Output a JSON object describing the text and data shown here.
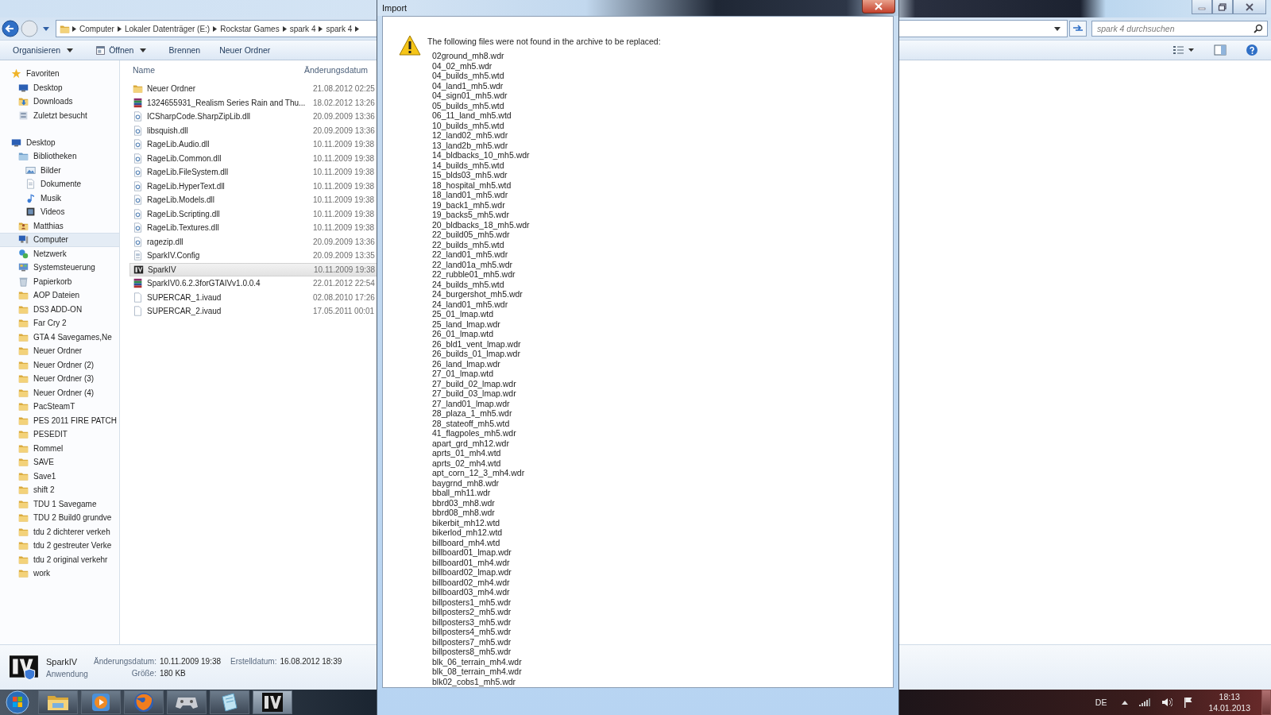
{
  "explorer": {
    "breadcrumb": [
      "Computer",
      "Lokaler Datenträger (E:)",
      "Rockstar Games",
      "spark 4",
      "spark 4"
    ],
    "search": {
      "placeholder": "spark 4 durchsuchen"
    },
    "toolbar": [
      {
        "label": "Organisieren",
        "kind": "menu"
      },
      {
        "label": "Öffnen",
        "kind": "split"
      },
      {
        "label": "Brennen",
        "kind": "plain"
      },
      {
        "label": "Neuer Ordner",
        "kind": "plain"
      }
    ],
    "nav": [
      {
        "label": "Favoriten",
        "kind": "star",
        "selected": false,
        "children": [
          {
            "label": "Desktop",
            "kind": "monitor",
            "selected": false
          },
          {
            "label": "Downloads",
            "kind": "downloads",
            "selected": false
          },
          {
            "label": "Zuletzt besucht",
            "kind": "recent",
            "selected": false
          }
        ]
      },
      {
        "label": "Desktop",
        "kind": "monitor",
        "selected": false,
        "children": [
          {
            "label": "Bibliotheken",
            "kind": "library",
            "selected": false,
            "children": [
              {
                "label": "Bilder",
                "kind": "pictures",
                "selected": false
              },
              {
                "label": "Dokumente",
                "kind": "documents",
                "selected": false
              },
              {
                "label": "Musik",
                "kind": "music",
                "selected": false
              },
              {
                "label": "Videos",
                "kind": "videos",
                "selected": false
              }
            ]
          },
          {
            "label": "Matthias",
            "kind": "user",
            "selected": false
          },
          {
            "label": "Computer",
            "kind": "computer",
            "selected": true
          },
          {
            "label": "Netzwerk",
            "kind": "network",
            "selected": false
          },
          {
            "label": "Systemsteuerung",
            "kind": "controlpanel",
            "selected": false
          },
          {
            "label": "Papierkorb",
            "kind": "trash",
            "selected": false
          },
          {
            "label": "AOP Dateien",
            "kind": "folder",
            "selected": false
          },
          {
            "label": "DS3 ADD-ON",
            "kind": "folder",
            "selected": false
          },
          {
            "label": "Far Cry 2",
            "kind": "folder",
            "selected": false
          },
          {
            "label": "GTA 4 Savegames,Ne",
            "kind": "folder",
            "selected": false
          },
          {
            "label": "Neuer Ordner",
            "kind": "folder",
            "selected": false
          },
          {
            "label": "Neuer Ordner (2)",
            "kind": "folder",
            "selected": false
          },
          {
            "label": "Neuer Ordner (3)",
            "kind": "folder",
            "selected": false
          },
          {
            "label": "Neuer Ordner (4)",
            "kind": "folder",
            "selected": false
          },
          {
            "label": "PacSteamT",
            "kind": "folder",
            "selected": false
          },
          {
            "label": "PES 2011 FIRE PATCH",
            "kind": "folder",
            "selected": false
          },
          {
            "label": "PESEDIT",
            "kind": "folder",
            "selected": false
          },
          {
            "label": "Rommel",
            "kind": "folder",
            "selected": false
          },
          {
            "label": "SAVE",
            "kind": "folder",
            "selected": false
          },
          {
            "label": "Save1",
            "kind": "folder",
            "selected": false
          },
          {
            "label": "shift 2",
            "kind": "folder",
            "selected": false
          },
          {
            "label": "TDU 1 Savegame",
            "kind": "folder",
            "selected": false
          },
          {
            "label": "TDU 2 Build0 grundve",
            "kind": "folder",
            "selected": false
          },
          {
            "label": "tdu 2 dichterer verkeh",
            "kind": "folder",
            "selected": false
          },
          {
            "label": "tdu 2 gestreuter Verke",
            "kind": "folder",
            "selected": false
          },
          {
            "label": "tdu 2 original verkehr",
            "kind": "folder",
            "selected": false
          },
          {
            "label": "work",
            "kind": "folder",
            "selected": false
          }
        ]
      }
    ],
    "columns": [
      "Name",
      "Änderungsdatum"
    ],
    "files": [
      {
        "name": "Neuer Ordner",
        "date": "21.08.2012 02:25",
        "kind": "folder",
        "selected": false
      },
      {
        "name": "1324655931_Realism Series Rain and Thu...",
        "date": "18.02.2012 13:26",
        "kind": "archive",
        "selected": false
      },
      {
        "name": "ICSharpCode.SharpZipLib.dll",
        "date": "20.09.2009 13:36",
        "kind": "dll",
        "selected": false
      },
      {
        "name": "libsquish.dll",
        "date": "20.09.2009 13:36",
        "kind": "dll",
        "selected": false
      },
      {
        "name": "RageLib.Audio.dll",
        "date": "10.11.2009 19:38",
        "kind": "dll",
        "selected": false
      },
      {
        "name": "RageLib.Common.dll",
        "date": "10.11.2009 19:38",
        "kind": "dll",
        "selected": false
      },
      {
        "name": "RageLib.FileSystem.dll",
        "date": "10.11.2009 19:38",
        "kind": "dll",
        "selected": false
      },
      {
        "name": "RageLib.HyperText.dll",
        "date": "10.11.2009 19:38",
        "kind": "dll",
        "selected": false
      },
      {
        "name": "RageLib.Models.dll",
        "date": "10.11.2009 19:38",
        "kind": "dll",
        "selected": false
      },
      {
        "name": "RageLib.Scripting.dll",
        "date": "10.11.2009 19:38",
        "kind": "dll",
        "selected": false
      },
      {
        "name": "RageLib.Textures.dll",
        "date": "10.11.2009 19:38",
        "kind": "dll",
        "selected": false
      },
      {
        "name": "ragezip.dll",
        "date": "20.09.2009 13:36",
        "kind": "dll",
        "selected": false
      },
      {
        "name": "SparkIV.Config",
        "date": "20.09.2009 13:35",
        "kind": "config",
        "selected": false
      },
      {
        "name": "SparkIV",
        "date": "10.11.2009 19:38",
        "kind": "app",
        "selected": true
      },
      {
        "name": "SparkIV0.6.2.3forGTAIVv1.0.0.4",
        "date": "22.01.2012 22:54",
        "kind": "archive",
        "selected": false
      },
      {
        "name": "SUPERCAR_1.ivaud",
        "date": "02.08.2010 17:26",
        "kind": "file",
        "selected": false
      },
      {
        "name": "SUPERCAR_2.ivaud",
        "date": "17.05.2011 00:01",
        "kind": "file",
        "selected": false
      }
    ],
    "details": {
      "name": "SparkIV",
      "type": "Anwendung",
      "fields": [
        {
          "label": "Änderungsdatum:",
          "value": "10.11.2009 19:38"
        },
        {
          "label": "Größe:",
          "value": "180 KB"
        },
        {
          "label": "Erstelldatum:",
          "value": "16.08.2012 18:39"
        }
      ]
    }
  },
  "dialog": {
    "title": "Import",
    "message": "The following files were not found in the archive to be replaced:",
    "files": [
      "02ground_mh8.wdr",
      "04_02_mh5.wdr",
      "04_builds_mh5.wtd",
      "04_land1_mh5.wdr",
      "04_sign01_mh5.wdr",
      "05_builds_mh5.wtd",
      "06_11_land_mh5.wtd",
      "10_builds_mh5.wtd",
      "12_land02_mh5.wdr",
      "13_land2b_mh5.wdr",
      "14_bldbacks_10_mh5.wdr",
      "14_builds_mh5.wtd",
      "15_blds03_mh5.wdr",
      "18_hospital_mh5.wtd",
      "18_land01_mh5.wdr",
      "19_back1_mh5.wdr",
      "19_backs5_mh5.wdr",
      "20_bldbacks_18_mh5.wdr",
      "22_build05_mh5.wdr",
      "22_builds_mh5.wtd",
      "22_land01_mh5.wdr",
      "22_land01a_mh5.wdr",
      "22_rubble01_mh5.wdr",
      "24_builds_mh5.wtd",
      "24_burgershot_mh5.wdr",
      "24_land01_mh5.wdr",
      "25_01_lmap.wtd",
      "25_land_lmap.wdr",
      "26_01_lmap.wtd",
      "26_bld1_vent_lmap.wdr",
      "26_builds_01_lmap.wdr",
      "26_land_lmap.wdr",
      "27_01_lmap.wtd",
      "27_build_02_lmap.wdr",
      "27_build_03_lmap.wdr",
      "27_land01_lmap.wdr",
      "28_plaza_1_mh5.wdr",
      "28_stateoff_mh5.wtd",
      "41_flagpoles_mh5.wdr",
      "apart_grd_mh12.wdr",
      "aprts_01_mh4.wtd",
      "aprts_02_mh4.wtd",
      "apt_corn_12_3_mh4.wdr",
      "baygrnd_mh8.wdr",
      "bball_mh11.wdr",
      "bbrd03_mh8.wdr",
      "bbrd08_mh8.wdr",
      "bikerbit_mh12.wtd",
      "bikerlod_mh12.wtd",
      "billboard_mh4.wtd",
      "billboard01_lmap.wdr",
      "billboard01_mh4.wdr",
      "billboard02_lmap.wdr",
      "billboard02_mh4.wdr",
      "billboard03_mh4.wdr",
      "billposters1_mh5.wdr",
      "billposters2_mh5.wdr",
      "billposters3_mh5.wdr",
      "billposters4_mh5.wdr",
      "billposters7_mh5.wdr",
      "billposters8_mh5.wdr",
      "blk_06_terrain_mh4.wdr",
      "blk_08_terrain_mh4.wdr",
      "blk02_cobs1_mh5.wdr"
    ]
  },
  "taskbar": {
    "language": "DE",
    "time": "18:13",
    "date": "14.01.2013"
  }
}
